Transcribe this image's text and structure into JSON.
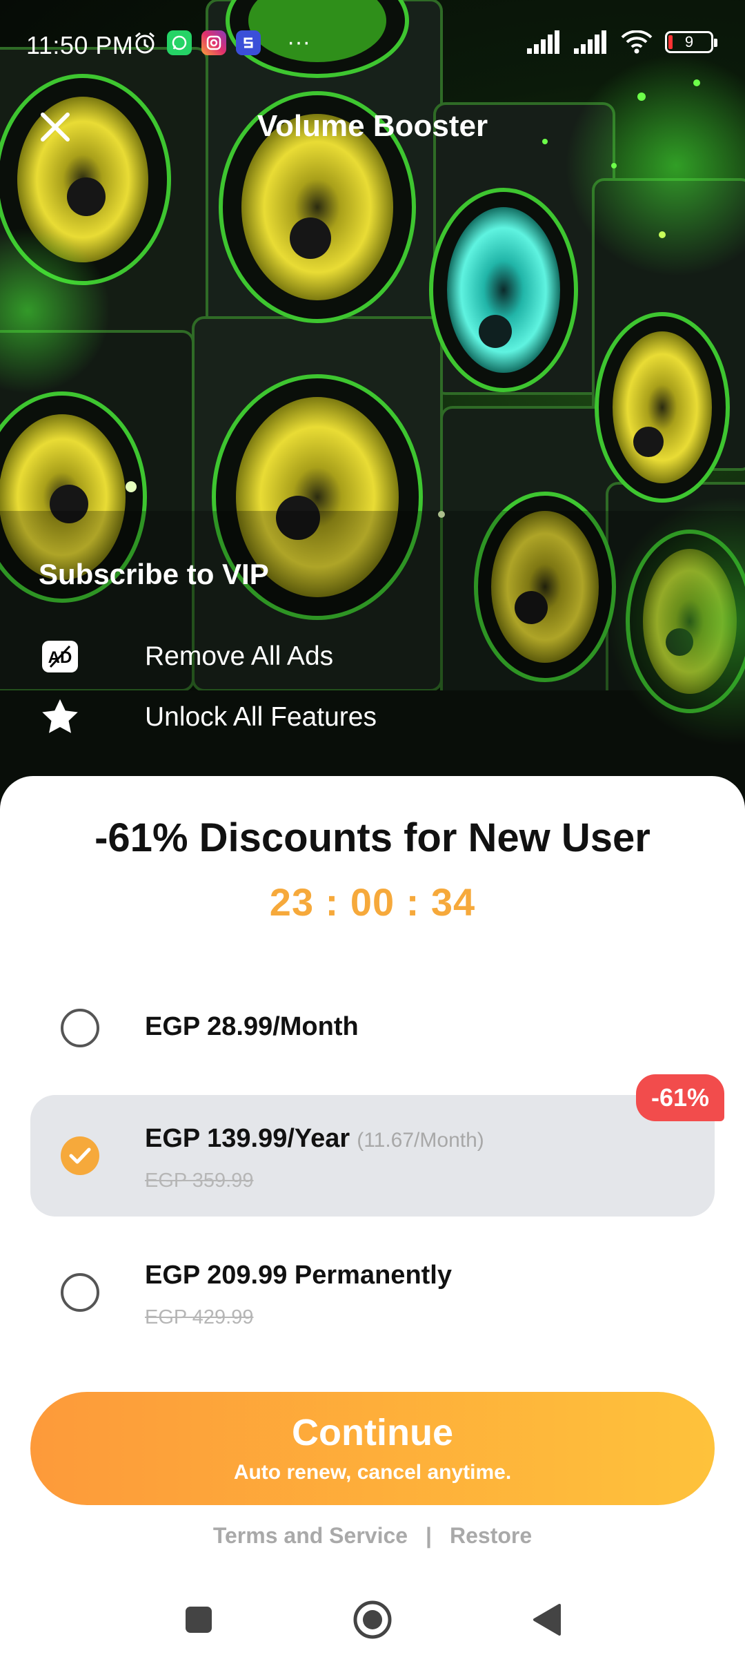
{
  "status_bar": {
    "time": "11:50 PM",
    "more": "···",
    "battery": "9",
    "left_icons": [
      "alarm-icon",
      "whatsapp-icon",
      "instagram-icon",
      "app-icon"
    ],
    "right_icons": [
      "signal-icon",
      "signal-icon",
      "wifi-icon",
      "battery-icon"
    ]
  },
  "header": {
    "title": "Volume Booster",
    "close_icon": "close-icon"
  },
  "vip": {
    "title": "Subscribe to VIP",
    "features": [
      {
        "icon": "no-ads-icon",
        "label": "Remove All Ads"
      },
      {
        "icon": "star-icon",
        "label": "Unlock All Features"
      }
    ]
  },
  "offer": {
    "headline": "-61% Discounts for New User",
    "countdown": "23 : 00 : 34"
  },
  "plans": [
    {
      "price": "EGP 28.99/Month",
      "per_month": "",
      "original": "",
      "selected": false
    },
    {
      "price": "EGP 139.99/Year",
      "per_month": "(11.67/Month)",
      "original": "EGP 359.99",
      "selected": true,
      "badge": "-61%"
    },
    {
      "price": "EGP 209.99 Permanently",
      "per_month": "",
      "original": "EGP 429.99",
      "selected": false
    }
  ],
  "cta": {
    "label": "Continue",
    "sublabel": "Auto renew, cancel anytime."
  },
  "footer": {
    "terms": "Terms and Service",
    "separator": "|",
    "restore": "Restore"
  },
  "colors": {
    "accent": "#f6a93b",
    "badge": "#f24c4c",
    "cta_start": "#fd9a3a",
    "cta_end": "#fec23b",
    "selected_bg": "#e4e6ea"
  },
  "nav": [
    "recents-icon",
    "home-icon",
    "back-icon"
  ]
}
